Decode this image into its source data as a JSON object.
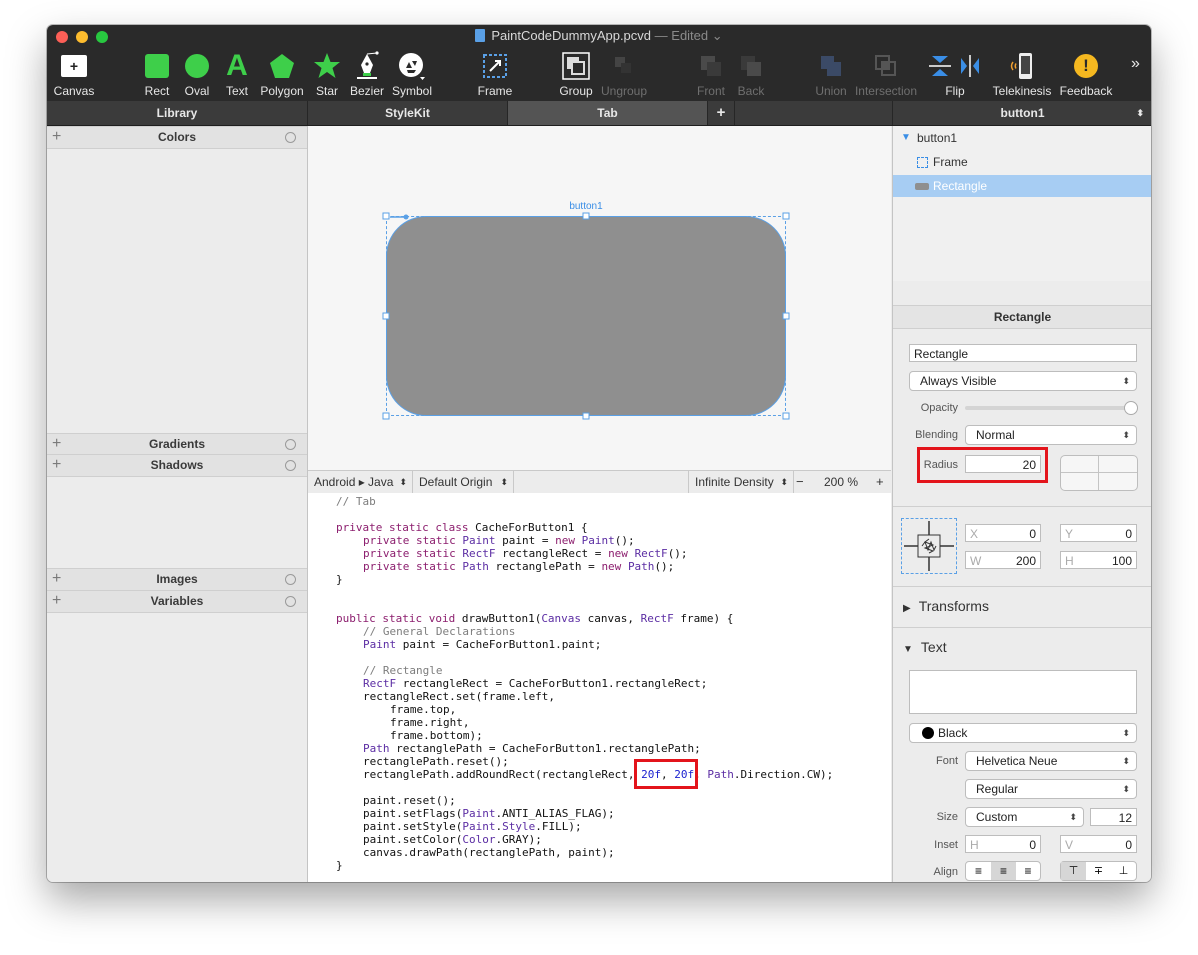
{
  "window": {
    "title": "PaintCodeDummyApp.pcvd",
    "status": "— Edited",
    "colors": {
      "accent": "#3a8ee6",
      "highlight": "#e3141b",
      "toolbar_bg": "#2a2a2a"
    }
  },
  "toolbar": {
    "canvas": "Canvas",
    "rect": "Rect",
    "oval": "Oval",
    "text": "Text",
    "polygon": "Polygon",
    "star": "Star",
    "bezier": "Bezier",
    "symbol": "Symbol",
    "frame": "Frame",
    "group": "Group",
    "ungroup": "Ungroup",
    "front": "Front",
    "back": "Back",
    "union": "Union",
    "intersection": "Intersection",
    "flip": "Flip",
    "telekinesis": "Telekinesis",
    "feedback": "Feedback",
    "more": "»"
  },
  "tabs": {
    "library": "Library",
    "stylekit": "StyleKit",
    "tab": "Tab",
    "add": "+",
    "inspector_target": "button1"
  },
  "library": {
    "colors": "Colors",
    "gradients": "Gradients",
    "shadows": "Shadows",
    "images": "Images",
    "variables": "Variables"
  },
  "canvas": {
    "shape_label": "button1",
    "shape_fill": "#8f8f8f"
  },
  "canvas_bar": {
    "platform": "Android ▸ Java",
    "origin": "Default Origin",
    "density": "Infinite Density",
    "zoom_out": "−",
    "zoom": "200 %",
    "zoom_in": "+"
  },
  "code": {
    "l0": "// Tab",
    "l1a": "private static class",
    "l1b": " CacheForButton1 {",
    "l2a": "private static",
    "l2b": "Paint",
    "l2c": " paint = ",
    "l2d": "new",
    "l2e": "Paint",
    "l2f": "();",
    "l3a": "private static",
    "l3b": "RectF",
    "l3c": " rectangleRect = ",
    "l3d": "new",
    "l3e": "RectF",
    "l3f": "();",
    "l4a": "private static",
    "l4b": "Path",
    "l4c": " rectanglePath = ",
    "l4d": "new",
    "l4e": "Path",
    "l4f": "();",
    "l5": "}",
    "l6a": "public static void",
    "l6b": " drawButton1(",
    "l6c": "Canvas",
    "l6d": " canvas, ",
    "l6e": "RectF",
    "l6f": " frame) {",
    "l7": "// General Declarations",
    "l8a": "Paint",
    "l8b": " paint = CacheForButton1.paint;",
    "l9": "// Rectangle",
    "l10a": "RectF",
    "l10b": " rectangleRect = CacheForButton1.rectangleRect;",
    "l11": "rectangleRect.set(frame.left,",
    "l12": "frame.top,",
    "l13": "frame.right,",
    "l14": "frame.bottom);",
    "l15a": "Path",
    "l15b": " rectanglePath = CacheForButton1.rectanglePath;",
    "l16": "rectanglePath.reset();",
    "l17a": "rectanglePath.addRoundRect(rectangleRect, ",
    "l17b": "20f",
    "l17c": ", ",
    "l17d": "20f",
    "l17e": ", ",
    "l17f": "Path",
    "l17g": ".Direction.CW);",
    "l18": "paint.reset();",
    "l19a": "paint.setFlags(",
    "l19b": "Paint",
    "l19c": ".ANTI_ALIAS_FLAG);",
    "l20a": "paint.setStyle(",
    "l20b": "Paint",
    "l20c": ".",
    "l20d": "Style",
    "l20e": ".FILL);",
    "l21a": "paint.setColor(",
    "l21b": "Color",
    "l21c": ".GRAY);",
    "l22": "canvas.drawPath(rectanglePath, paint);",
    "l23": "}"
  },
  "tree": {
    "root": "button1",
    "frame": "Frame",
    "rect": "Rectangle"
  },
  "inspector": {
    "section": "Rectangle",
    "name": "Rectangle",
    "visibility": "Always Visible",
    "opacity_label": "Opacity",
    "blending_label": "Blending",
    "blending": "Normal",
    "radius_label": "Radius",
    "radius": "20",
    "x_label": "X",
    "x": "0",
    "y_label": "Y",
    "y": "0",
    "w_label": "W",
    "w": "200",
    "h_label": "H",
    "h": "100",
    "transforms": "Transforms",
    "text": "Text",
    "color": "Black",
    "font_label": "Font",
    "font": "Helvetica Neue",
    "weight": "Regular",
    "size_label": "Size",
    "size_mode": "Custom",
    "size": "12",
    "inset_label": "Inset",
    "inset_h_label": "H",
    "inset_h": "0",
    "inset_v_label": "V",
    "inset_v": "0",
    "align_label": "Align"
  }
}
